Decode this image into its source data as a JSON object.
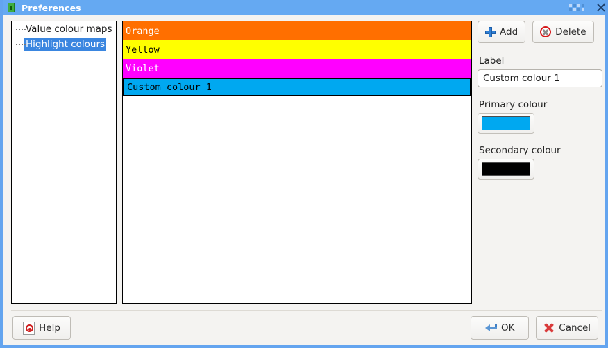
{
  "window": {
    "title": "Preferences",
    "icon": "app-icon",
    "close_icon": "close-icon",
    "accent": "#65a9f2"
  },
  "tree": {
    "items": [
      {
        "label": "Value colour maps",
        "selected": false
      },
      {
        "label": "Highlight colours",
        "selected": true
      }
    ]
  },
  "colour_list": {
    "rows": [
      {
        "label": "Orange",
        "bg": "#ff6f00",
        "fg": "#ffffff",
        "selected": false
      },
      {
        "label": "Yellow",
        "bg": "#ffff00",
        "fg": "#000000",
        "selected": false
      },
      {
        "label": "Violet",
        "bg": "#ff00ff",
        "fg": "#ffffff",
        "selected": false
      },
      {
        "label": "Custom colour 1",
        "bg": "#00a8f0",
        "fg": "#000000",
        "selected": true
      }
    ]
  },
  "side_panel": {
    "add_label": "Add",
    "add_icon": "plus-icon",
    "delete_label": "Delete",
    "delete_icon": "delete-circle-icon",
    "label_caption": "Label",
    "label_value": "Custom colour 1",
    "label_placeholder": "Label",
    "primary_caption": "Primary colour",
    "primary_colour": "#00a8f0",
    "secondary_caption": "Secondary colour",
    "secondary_colour": "#000000"
  },
  "footer": {
    "help_label": "Help",
    "help_icon": "help-icon",
    "ok_label": "OK",
    "ok_icon": "enter-arrow-icon",
    "cancel_label": "Cancel",
    "cancel_icon": "cross-icon"
  }
}
